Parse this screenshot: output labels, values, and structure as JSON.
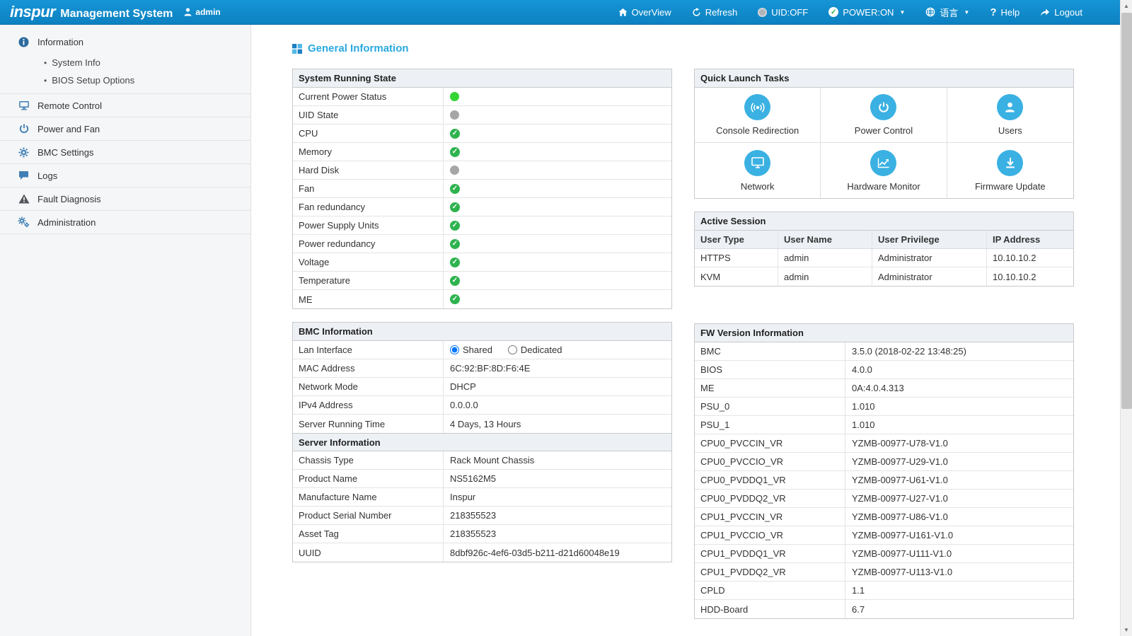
{
  "header": {
    "logo": "inspur",
    "title": "Management System",
    "user": "admin",
    "nav": {
      "overview": "OverView",
      "refresh": "Refresh",
      "uid": "UID:OFF",
      "power": "POWER:ON",
      "language": "语言",
      "help": "Help",
      "logout": "Logout"
    }
  },
  "sidebar": {
    "items": [
      {
        "label": "Information",
        "icon": "info-icon"
      },
      {
        "label": "System Info"
      },
      {
        "label": "BIOS Setup Options"
      },
      {
        "label": "Remote Control",
        "icon": "monitor-icon"
      },
      {
        "label": "Power and Fan",
        "icon": "power-icon"
      },
      {
        "label": "BMC Settings",
        "icon": "gear-icon"
      },
      {
        "label": "Logs",
        "icon": "chat-icon"
      },
      {
        "label": "Fault Diagnosis",
        "icon": "warning-icon"
      },
      {
        "label": "Administration",
        "icon": "gears-icon"
      }
    ]
  },
  "page": {
    "title": "General Information"
  },
  "system_state": {
    "title": "System Running State",
    "rows": [
      {
        "label": "Current Power Status",
        "status": "dot-green"
      },
      {
        "label": "UID State",
        "status": "dot-gray"
      },
      {
        "label": "CPU",
        "status": "check-green"
      },
      {
        "label": "Memory",
        "status": "check-green"
      },
      {
        "label": "Hard Disk",
        "status": "dot-gray"
      },
      {
        "label": "Fan",
        "status": "check-green"
      },
      {
        "label": "Fan redundancy",
        "status": "check-green"
      },
      {
        "label": "Power Supply Units",
        "status": "check-green"
      },
      {
        "label": "Power redundancy",
        "status": "check-green"
      },
      {
        "label": "Voltage",
        "status": "check-green"
      },
      {
        "label": "Temperature",
        "status": "check-green"
      },
      {
        "label": "ME",
        "status": "check-green"
      }
    ]
  },
  "quick_launch": {
    "title": "Quick Launch Tasks",
    "items": [
      {
        "label": "Console Redirection",
        "icon": "console-redirection-icon"
      },
      {
        "label": "Power Control",
        "icon": "power-control-icon"
      },
      {
        "label": "Users",
        "icon": "users-icon"
      },
      {
        "label": "Network",
        "icon": "network-icon"
      },
      {
        "label": "Hardware Monitor",
        "icon": "hardware-monitor-icon"
      },
      {
        "label": "Firmware Update",
        "icon": "firmware-update-icon"
      }
    ]
  },
  "active_session": {
    "title": "Active Session",
    "columns": [
      "User Type",
      "User Name",
      "User Privilege",
      "IP Address"
    ],
    "rows": [
      [
        "HTTPS",
        "admin",
        "Administrator",
        "10.10.10.2"
      ],
      [
        "KVM",
        "admin",
        "Administrator",
        "10.10.10.2"
      ]
    ]
  },
  "bmc_info": {
    "title": "BMC Information",
    "lan_interface_label": "Lan Interface",
    "lan_options": [
      "Shared",
      "Dedicated"
    ],
    "lan_selected": "Shared",
    "rows": [
      {
        "label": "MAC Address",
        "value": "6C:92:BF:8D:F6:4E"
      },
      {
        "label": "Network Mode",
        "value": "DHCP"
      },
      {
        "label": "IPv4 Address",
        "value": "0.0.0.0"
      },
      {
        "label": "Server Running Time",
        "value": "4 Days, 13 Hours"
      }
    ]
  },
  "server_info": {
    "title": "Server Information",
    "rows": [
      {
        "label": "Chassis Type",
        "value": "Rack Mount Chassis"
      },
      {
        "label": "Product Name",
        "value": "NS5162M5"
      },
      {
        "label": "Manufacture Name",
        "value": "Inspur"
      },
      {
        "label": "Product Serial Number",
        "value": "218355523"
      },
      {
        "label": "Asset Tag",
        "value": "218355523"
      },
      {
        "label": "UUID",
        "value": "8dbf926c-4ef6-03d5-b211-d21d60048e19"
      }
    ]
  },
  "fw_info": {
    "title": "FW Version Information",
    "rows": [
      {
        "label": "BMC",
        "value": "3.5.0 (2018-02-22 13:48:25)"
      },
      {
        "label": "BIOS",
        "value": "4.0.0"
      },
      {
        "label": "ME",
        "value": "0A:4.0.4.313"
      },
      {
        "label": "PSU_0",
        "value": "1.010"
      },
      {
        "label": "PSU_1",
        "value": "1.010"
      },
      {
        "label": "CPU0_PVCCIN_VR",
        "value": "YZMB-00977-U78-V1.0"
      },
      {
        "label": "CPU0_PVCCIO_VR",
        "value": "YZMB-00977-U29-V1.0"
      },
      {
        "label": "CPU0_PVDDQ1_VR",
        "value": "YZMB-00977-U61-V1.0"
      },
      {
        "label": "CPU0_PVDDQ2_VR",
        "value": "YZMB-00977-U27-V1.0"
      },
      {
        "label": "CPU1_PVCCIN_VR",
        "value": "YZMB-00977-U86-V1.0"
      },
      {
        "label": "CPU1_PVCCIO_VR",
        "value": "YZMB-00977-U161-V1.0"
      },
      {
        "label": "CPU1_PVDDQ1_VR",
        "value": "YZMB-00977-U111-V1.0"
      },
      {
        "label": "CPU1_PVDDQ2_VR",
        "value": "YZMB-00977-U113-V1.0"
      },
      {
        "label": "CPLD",
        "value": "1.1"
      },
      {
        "label": "HDD-Board",
        "value": "6.7"
      }
    ]
  },
  "colors": {
    "header_bg": "#0e86ca",
    "accent_blue": "#29a9e0",
    "status_green": "#2eb34f",
    "power_on_green": "#35d435",
    "status_gray": "#a6a6a6"
  }
}
